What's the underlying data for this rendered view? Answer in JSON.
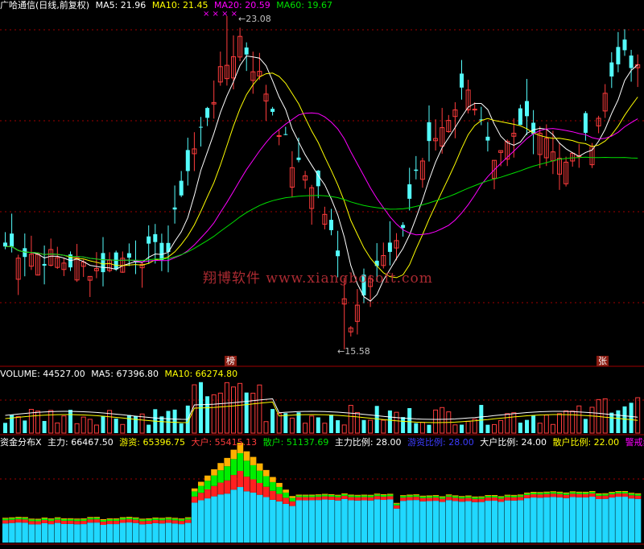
{
  "main_header": {
    "title": "广哈通信(日线,前复权)",
    "ma5": "MA5: 21.96",
    "ma10": "MA10: 21.45",
    "ma20": "MA20: 20.59",
    "ma60": "MA60: 19.67"
  },
  "annotations": {
    "high_label": "23.08",
    "low_label": "15.58",
    "tag_bang": "榜",
    "tag_zhang": "张",
    "signal_marks": "× × × ×"
  },
  "watermark": "翔博软件 www.xiangbosoft.com",
  "volume_header": {
    "volume": "VOLUME: 44527.00",
    "ma5": "MA5: 67396.80",
    "ma10": "MA10: 66274.80"
  },
  "fund_header": {
    "name": "资金分布X",
    "main": "主力: 66467.50",
    "hot": "游资: 65396.75",
    "big": "大户: 55415.13",
    "retail": "散户: 51137.69",
    "main_ratio": "主力比例: 28.00",
    "hot_ratio": "游资比例: 28.00",
    "big_ratio": "大户比例: 24.00",
    "retail_ratio": "散户比例: 22.00",
    "alert": "警戒线"
  },
  "colors": {
    "up": "#ff3c3c",
    "down": "#54fcfc",
    "ma5": "#ffffff",
    "ma10": "#ffff00",
    "ma20": "#ff00ff",
    "ma60": "#00e000",
    "grid": "#a00000"
  },
  "chart_data": {
    "type": "candlestick",
    "title": "广哈通信(日线,前复权)",
    "price_range": [
      15.58,
      23.08
    ],
    "highest": 23.08,
    "lowest": 15.58,
    "moving_averages": {
      "MA5": 21.96,
      "MA10": 21.45,
      "MA20": 20.59,
      "MA60": 19.67
    },
    "volume_latest": 44527.0,
    "volume_ma": {
      "MA5": 67396.8,
      "MA10": 66274.8
    },
    "fund_distribution": {
      "主力": 66467.5,
      "游资": 65396.75,
      "大户": 55415.13,
      "散户": 51137.69,
      "主力比例": 28.0,
      "游资比例": 28.0,
      "大户比例": 24.0,
      "散户比例": 22.0
    }
  }
}
